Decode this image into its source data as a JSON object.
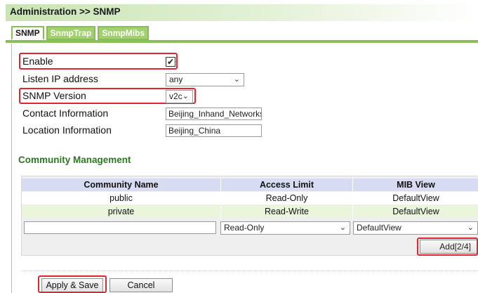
{
  "header": {
    "title": "Administration >> SNMP"
  },
  "tabs": [
    {
      "label": "SNMP",
      "active": true
    },
    {
      "label": "SnmpTrap",
      "active": false
    },
    {
      "label": "SnmpMibs",
      "active": false
    }
  ],
  "form": {
    "enable": {
      "label": "Enable",
      "checked": true,
      "check_glyph": "✔"
    },
    "listen_ip": {
      "label": "Listen IP address",
      "value": "any"
    },
    "snmp_version": {
      "label": "SNMP Version",
      "value": "v2c"
    },
    "contact": {
      "label": "Contact Information",
      "value": "Beijing_Inhand_Networks"
    },
    "location": {
      "label": "Location Information",
      "value": "Beijing_China"
    }
  },
  "community": {
    "title": "Community Management",
    "columns": [
      "Community Name",
      "Access Limit",
      "MIB View"
    ],
    "rows": [
      [
        "public",
        "Read-Only",
        "DefaultView"
      ],
      [
        "private",
        "Read-Write",
        "DefaultView"
      ]
    ],
    "new_row": {
      "name": "",
      "access": "Read-Only",
      "mib_view": "DefaultView"
    },
    "add_label": "Add[2/4]"
  },
  "actions": {
    "apply_label": "Apply & Save",
    "cancel_label": "Cancel"
  },
  "colors": {
    "accent": "#2a7a1e",
    "highlight": "#e0272f",
    "tab_green": "#a3d06e"
  }
}
